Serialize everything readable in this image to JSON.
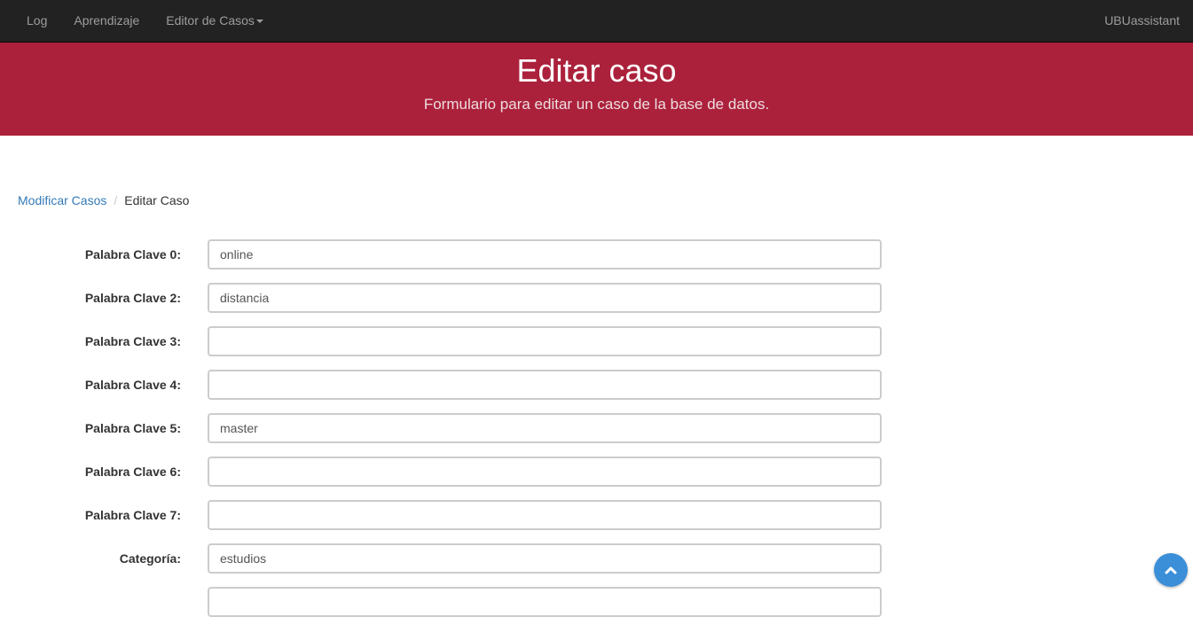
{
  "navbar": {
    "items": [
      {
        "label": "Log"
      },
      {
        "label": "Aprendizaje"
      },
      {
        "label": "Editor de Casos",
        "has_dropdown": true
      }
    ],
    "brand": "UBUassistant"
  },
  "header": {
    "title": "Editar caso",
    "subtitle": "Formulario para editar un caso de la base de datos.",
    "background_color": "#ab213b"
  },
  "breadcrumb": {
    "link": "Modificar Casos",
    "separator": "/",
    "active": "Editar Caso"
  },
  "form": {
    "fields": [
      {
        "label": "Palabra Clave 0:",
        "value": "online"
      },
      {
        "label": "Palabra Clave 2:",
        "value": "distancia"
      },
      {
        "label": "Palabra Clave 3:",
        "value": ""
      },
      {
        "label": "Palabra Clave 4:",
        "value": ""
      },
      {
        "label": "Palabra Clave 5:",
        "value": "master"
      },
      {
        "label": "Palabra Clave 6:",
        "value": ""
      },
      {
        "label": "Palabra Clave 7:",
        "value": ""
      },
      {
        "label": "Categoría:",
        "value": "estudios"
      },
      {
        "label": "",
        "value": ""
      }
    ]
  },
  "scroll_top": {
    "icon": "chevron-up-icon",
    "color": "#3a8fd8"
  }
}
